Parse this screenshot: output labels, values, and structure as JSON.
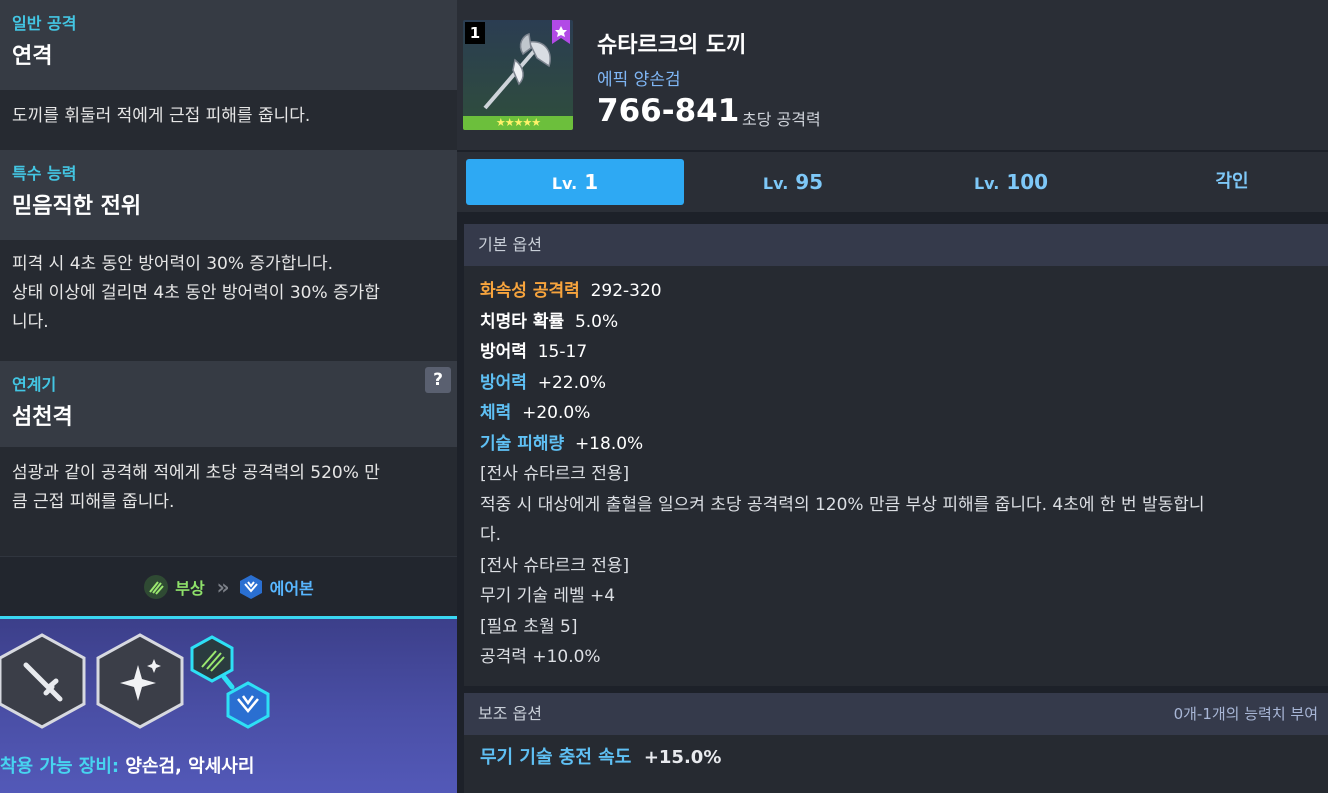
{
  "left": {
    "combo": {
      "category": "일반 공격",
      "title": "연격",
      "desc": "도끼를 휘둘러 적에게 근접 피해를 줍니다."
    },
    "special": {
      "category": "특수 능력",
      "title": "믿음직한 전위",
      "desc_lines": [
        "피격 시 4초 동안 방어력이 30% 증가합니다.",
        "상태 이상에 걸리면 4초 동안 방어력이 30% 증가합",
        "니다."
      ]
    },
    "chain": {
      "category": "연계기",
      "help": "?",
      "title": "섬천격",
      "desc_lines": [
        "섬광과 같이 공격해 적에게 초당 공격력의 520% 만",
        "큼 근접 피해를 줍니다."
      ]
    },
    "combo_row": {
      "from_label": "부상",
      "arrow": "»",
      "to_label": "에어본"
    },
    "equip": {
      "label": "착용 가능 장비:",
      "value": "양손검, 악세사리"
    }
  },
  "item": {
    "badge": "1",
    "stars": "★★★★★",
    "name": "슈타르크의 도끼",
    "sub": "에픽 양손검",
    "atk": "766-841",
    "atk_label": "초당 공격력"
  },
  "tabs": [
    {
      "prefix": "Lv.",
      "num": "1",
      "active": true
    },
    {
      "prefix": "Lv.",
      "num": "95",
      "active": false
    },
    {
      "prefix": "Lv.",
      "num": "100",
      "active": false
    },
    {
      "prefix": "",
      "num": "각인",
      "active": false
    }
  ],
  "base_options": {
    "header": "기본 옵션",
    "lines": [
      {
        "key": "화속성 공격력",
        "val": "292-320",
        "style": "orange"
      },
      {
        "key": "치명타 확률",
        "val": "5.0%",
        "style": "white"
      },
      {
        "key": "방어력",
        "val": "15-17",
        "style": "white"
      },
      {
        "key": "방어력",
        "val": "+22.0%",
        "style": "blue"
      },
      {
        "key": "체력",
        "val": "+20.0%",
        "style": "blue"
      },
      {
        "key": "기술 피해량",
        "val": "+18.0%",
        "style": "blue"
      }
    ],
    "text_lines": [
      "[전사 슈타르크 전용]",
      "적중 시 대상에게 출혈을 일으켜 초당 공격력의 120% 만큼 부상 피해를 줍니다. 4초에 한 번 발동합니",
      "다.",
      "[전사 슈타르크 전용]",
      "무기 기술 레벨 +4",
      "[필요 초월 5]",
      "공격력 +10.0%"
    ]
  },
  "sub_options": {
    "header": "보조 옵션",
    "note": "0개-1개의 능력치 부여",
    "line_key": "무기 기술 충전 속도",
    "line_val": "+15.0%"
  }
}
